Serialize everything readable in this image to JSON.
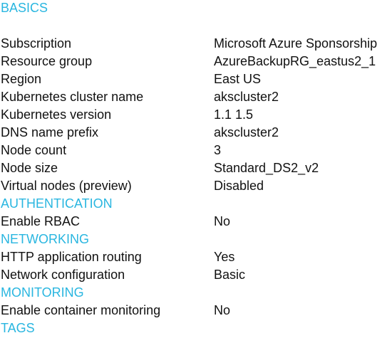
{
  "accent_color": "#29b6e0",
  "sections": {
    "basics": {
      "title": "BASICS",
      "rows": [
        {
          "label": "Subscription",
          "value": "Microsoft Azure Sponsorship"
        },
        {
          "label": "Resource group",
          "value": "AzureBackupRG_eastus2_1"
        },
        {
          "label": "Region",
          "value": "East US"
        },
        {
          "label": "Kubernetes cluster name",
          "value": "akscluster2"
        },
        {
          "label": "Kubernetes version",
          "value": "1.1 1.5"
        },
        {
          "label": "DNS name prefix",
          "value": "akscluster2"
        },
        {
          "label": "Node count",
          "value": "3"
        },
        {
          "label": "Node size",
          "value": "Standard_DS2_v2"
        },
        {
          "label": "Virtual nodes (preview)",
          "value": "Disabled"
        }
      ]
    },
    "authentication": {
      "title": "AUTHENTICATION",
      "rows": [
        {
          "label": "Enable RBAC",
          "value": "No"
        }
      ]
    },
    "networking": {
      "title": "NETWORKING",
      "rows": [
        {
          "label": "HTTP application routing",
          "value": "Yes"
        },
        {
          "label": "Network configuration",
          "value": "Basic"
        }
      ]
    },
    "monitoring": {
      "title": "MONITORING",
      "rows": [
        {
          "label": "Enable container monitoring",
          "value": "No"
        }
      ]
    },
    "tags": {
      "title": "TAGS"
    }
  }
}
